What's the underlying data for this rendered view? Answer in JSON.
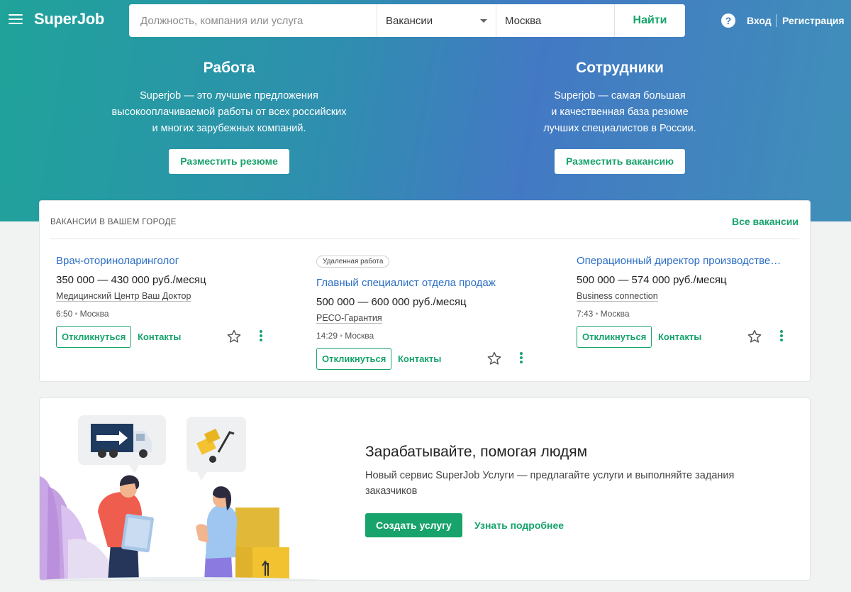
{
  "header": {
    "logo": "SuperJob",
    "search_placeholder": "Должность, компания или услуга",
    "type_select": "Вакансии",
    "city_value": "Москва",
    "search_button": "Найти",
    "help_label": "?",
    "login": "Вход",
    "register": "Регистрация"
  },
  "promo": {
    "left": {
      "title": "Работа",
      "text": "Superjob — это лучшие предложения\nвысокооплачиваемой работы от всех российских\nи многих зарубежных компаний.",
      "button": "Разместить резюме"
    },
    "right": {
      "title": "Сотрудники",
      "text": "Superjob — самая большая\nи качественная база резюме\nлучших специалистов в России.",
      "button": "Разместить вакансию"
    }
  },
  "vacancies": {
    "heading": "ВАКАНСИИ В ВАШЕМ ГОРОДЕ",
    "all_link": "Все вакансии",
    "items": [
      {
        "badge": "",
        "title": "Врач-оториноларинголог",
        "salary": "350 000 — 430 000 руб./месяц",
        "company": "Медицинский Центр Ваш Доктор",
        "time": "6:50",
        "city": "Москва",
        "respond": "Откликнуться",
        "contacts": "Контакты"
      },
      {
        "badge": "Удаленная работа",
        "title": "Главный специалист отдела продаж",
        "salary": "500 000 — 600 000 руб./месяц",
        "company": "РЕСО-Гарантия",
        "time": "14:29",
        "city": "Москва",
        "respond": "Откликнуться",
        "contacts": "Контакты"
      },
      {
        "badge": "",
        "title": "Операционный директор производстве…",
        "salary": "500 000 — 574 000 руб./месяц",
        "company": "Business connection",
        "time": "7:43",
        "city": "Москва",
        "respond": "Откликнуться",
        "contacts": "Контакты"
      }
    ]
  },
  "services": {
    "title": "Зарабатывайте, помогая людям",
    "description": "Новый сервис SuperJob Услуги — предлагайте услуги и выполняйте задания заказчиков",
    "create_button": "Создать услугу",
    "more_link": "Узнать подробнее"
  },
  "colors": {
    "accent_green": "#17a36b",
    "link_blue": "#2c6fc4",
    "hero_start": "#1fa39a",
    "hero_end": "#4379c4"
  }
}
